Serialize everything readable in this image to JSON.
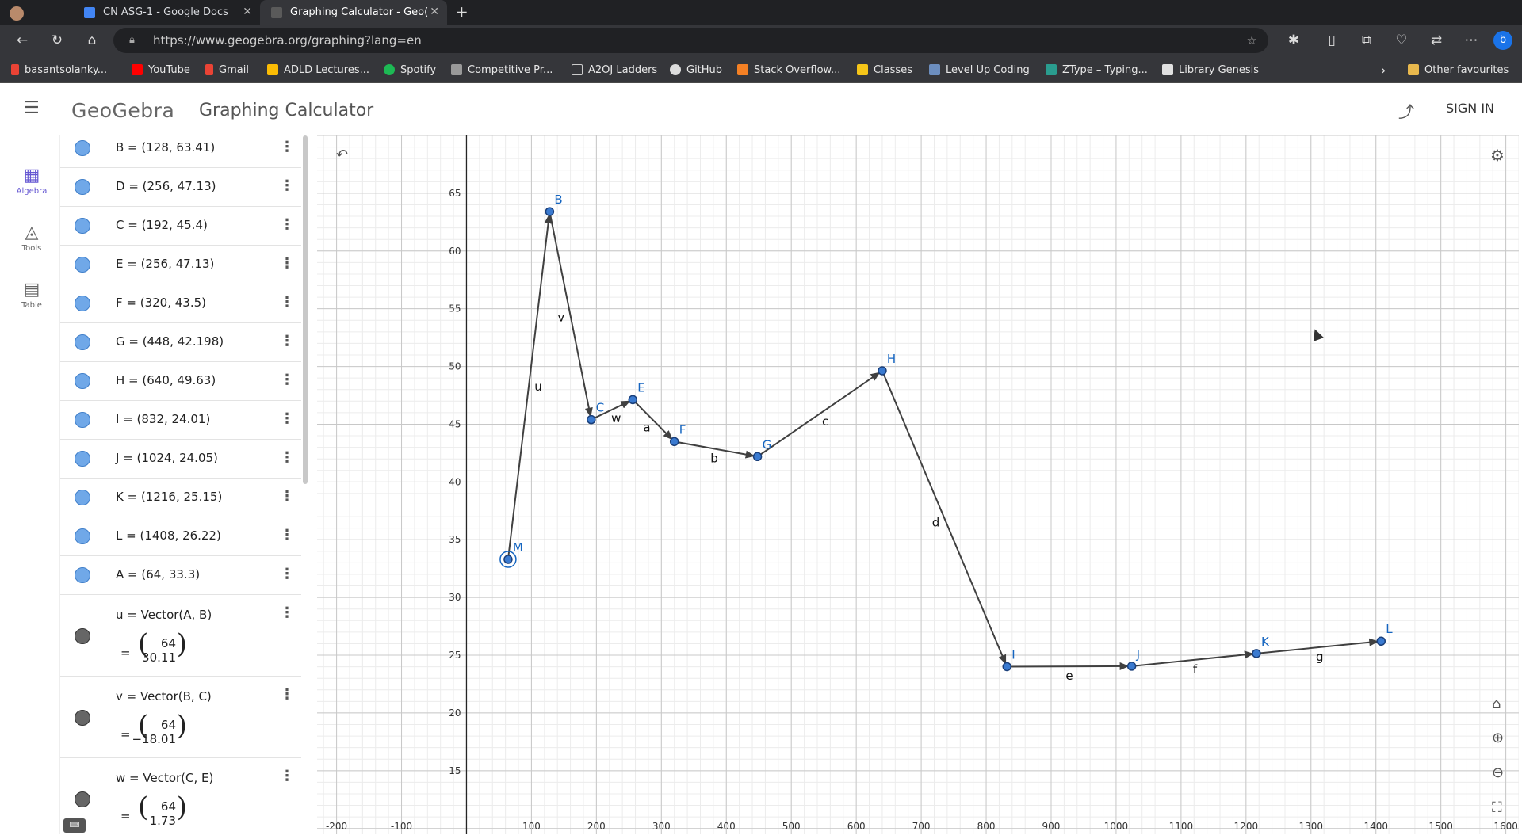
{
  "browser": {
    "tabs": [
      {
        "title": "CN ASG-1 - Google Docs",
        "close": "✕"
      },
      {
        "title": "Graphing Calculator - Geo(",
        "close": "✕"
      }
    ],
    "new_tab": "+",
    "url": "https://www.geogebra.org/graphing?lang=en",
    "bookmarks": [
      "basantsolanky...",
      "YouTube",
      "Gmail",
      "ADLD Lectures...",
      "Spotify",
      "Competitive Pr...",
      "A2OJ Ladders",
      "GitHub",
      "Stack Overflow...",
      "Classes",
      "Level Up Coding",
      "ZType – Typing...",
      "Library Genesis"
    ],
    "other_favourites": "Other favourites"
  },
  "app": {
    "logo": "GeoGebra",
    "title": "Graphing Calculator",
    "sign_in": "SIGN IN",
    "side_nav": [
      {
        "label": "Algebra",
        "icon": "calculator-icon"
      },
      {
        "label": "Tools",
        "icon": "tools-icon"
      },
      {
        "label": "Table",
        "icon": "table-icon"
      }
    ]
  },
  "algebra": {
    "points": [
      "B = (128, 63.41)",
      "D = (256, 47.13)",
      "C = (192, 45.4)",
      "E = (256, 47.13)",
      "F = (320, 43.5)",
      "G = (448, 42.198)",
      "H = (640, 49.63)",
      "I = (832, 24.01)",
      "J = (1024, 24.05)",
      "K = (1216, 25.15)",
      "L = (1408, 26.22)",
      "A = (64, 33.3)"
    ],
    "vectors": [
      {
        "def": "u = Vector(A, B)",
        "eq": "=",
        "x": "64",
        "y": "30.11"
      },
      {
        "def": "v = Vector(B, C)",
        "eq": "=",
        "x": "64",
        "y": "−18.01"
      },
      {
        "def": "w = Vector(C, E)",
        "eq": "=",
        "x": "64",
        "y": "1.73"
      }
    ]
  },
  "chart_data": {
    "type": "line",
    "x_ticks": [
      -200,
      -100,
      100,
      200,
      300,
      400,
      500,
      600,
      700,
      800,
      900,
      1000,
      1100,
      1200,
      1300,
      1400,
      1500,
      1600
    ],
    "y_ticks": [
      15,
      20,
      25,
      30,
      35,
      40,
      45,
      50,
      55,
      60,
      65
    ],
    "xlim": [
      -230,
      1620
    ],
    "ylim": [
      9.5,
      70
    ],
    "grid": true,
    "points": [
      {
        "name": "M",
        "x": 64,
        "y": 33.3
      },
      {
        "name": "B",
        "x": 128,
        "y": 63.41
      },
      {
        "name": "C",
        "x": 192,
        "y": 45.4
      },
      {
        "name": "E",
        "x": 256,
        "y": 47.13
      },
      {
        "name": "F",
        "x": 320,
        "y": 43.5
      },
      {
        "name": "G",
        "x": 448,
        "y": 42.198
      },
      {
        "name": "H",
        "x": 640,
        "y": 49.63
      },
      {
        "name": "I",
        "x": 832,
        "y": 24.01
      },
      {
        "name": "J",
        "x": 1024,
        "y": 24.05
      },
      {
        "name": "K",
        "x": 1216,
        "y": 25.15
      },
      {
        "name": "L",
        "x": 1408,
        "y": 26.22
      }
    ],
    "vectors": [
      {
        "name": "u",
        "from": "M",
        "to": "B"
      },
      {
        "name": "v",
        "from": "B",
        "to": "C"
      },
      {
        "name": "w",
        "from": "C",
        "to": "E"
      },
      {
        "name": "a",
        "from": "E",
        "to": "F"
      },
      {
        "name": "b",
        "from": "F",
        "to": "G"
      },
      {
        "name": "c",
        "from": "G",
        "to": "H"
      },
      {
        "name": "d",
        "from": "H",
        "to": "I"
      },
      {
        "name": "e",
        "from": "I",
        "to": "J"
      },
      {
        "name": "f",
        "from": "J",
        "to": "K"
      },
      {
        "name": "g",
        "from": "K",
        "to": "L"
      }
    ],
    "colors": {
      "point": "#1565c0",
      "point_fill": "#3a7ad0",
      "vector": "#404040",
      "axis": "#252525",
      "grid_major": "#c8c8c8",
      "grid_minor": "#ececec"
    }
  }
}
